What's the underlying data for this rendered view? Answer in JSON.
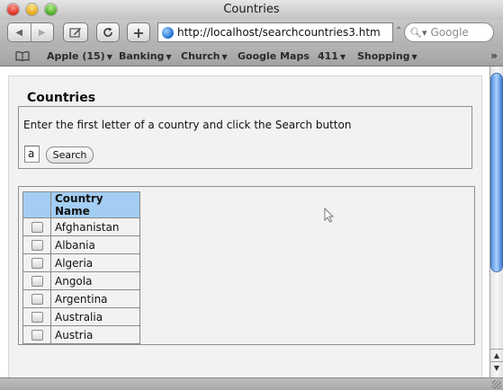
{
  "window": {
    "title": "Countries"
  },
  "toolbar": {
    "back_icon": "back-arrow",
    "forward_icon": "forward-arrow",
    "edit_icon": "pencil",
    "reload_icon": "reload",
    "add_icon": "+",
    "url": "http://localhost/searchcountries3.htm",
    "search_placeholder": "Google"
  },
  "bookmarks": {
    "items": [
      {
        "label": "Apple (15)",
        "has_menu": true
      },
      {
        "label": "Banking",
        "has_menu": true
      },
      {
        "label": "Church",
        "has_menu": true
      },
      {
        "label": "Google Maps",
        "has_menu": false
      },
      {
        "label": "411",
        "has_menu": true
      },
      {
        "label": "Shopping",
        "has_menu": true
      }
    ],
    "more": "»"
  },
  "page": {
    "heading": "Countries",
    "instruction": "Enter the first letter of a country and click the Search button",
    "letter_value": "a",
    "search_button": "Search",
    "table": {
      "column_header": "Country Name",
      "rows": [
        "Afghanistan",
        "Albania",
        "Algeria",
        "Angola",
        "Argentina",
        "Australia",
        "Austria"
      ]
    }
  },
  "colors": {
    "table_header_bg": "#a3cdf2",
    "scroll_thumb": "#5c94e0"
  }
}
